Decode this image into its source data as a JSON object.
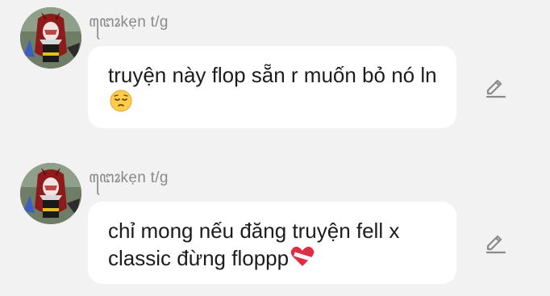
{
  "colors": {
    "background": "#f2f2f2",
    "bubble": "#ffffff",
    "text": "#1c1c1c",
    "username": "#8a8a8a",
    "icon": "#8a8a8a"
  },
  "messages": [
    {
      "username": "ꦔꦺꦴkẹn t/g",
      "text": "truyện này flop sẵn r muốn bỏ nó ln",
      "emoji_icon": "pensive-face-icon",
      "action_icon": "edit-pencil-icon"
    },
    {
      "username": "ꦔꦺꦴkẹn t/g",
      "text": "chỉ mong nếu đăng truyện fell x classic đừng floppp",
      "emoji_icon": "mending-heart-icon",
      "action_icon": "edit-pencil-icon"
    }
  ]
}
